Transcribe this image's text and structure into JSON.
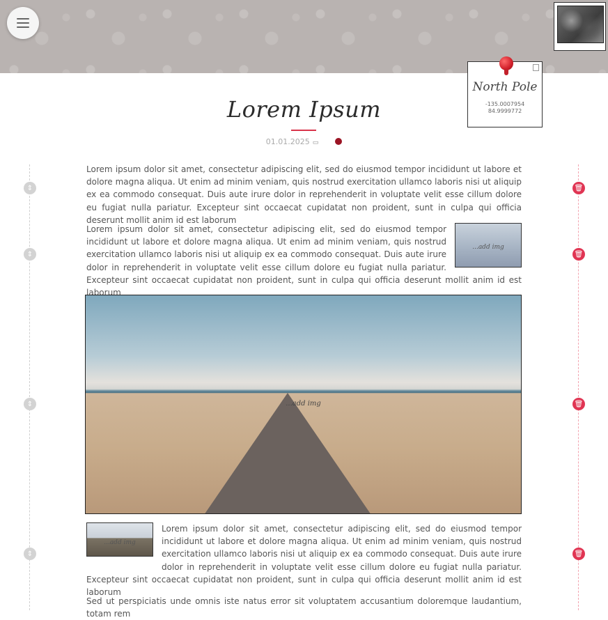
{
  "header": {
    "menu_icon": "hamburger-icon",
    "map_thumbnail": "map-thumbnail"
  },
  "location": {
    "name": "North Pole",
    "longitude": "-135.0007954",
    "latitude": "84.9999772",
    "pin_icon": "pushpin-icon",
    "corner_icon": "document-icon"
  },
  "post": {
    "title": "Lorem Ipsum",
    "date": "01.01.2025",
    "date_icon": "calendar-icon",
    "accent_color": "#9b1424",
    "rule_color": "#d9334a"
  },
  "blocks": [
    {
      "type": "text",
      "text": "Lorem ipsum dolor sit amet, consectetur adipiscing elit, sed do eiusmod tempor incididunt ut labore et dolore magna aliqua. Ut enim ad minim veniam, quis nostrud exercitation ullamco laboris nisi ut aliquip ex ea commodo consequat. Duis aute irure dolor in reprehenderit in voluptate velit esse cillum dolore eu fugiat nulla pariatur. Excepteur sint occaecat cupidatat non proident, sunt in culpa qui officia deserunt mollit anim id est laborum"
    },
    {
      "type": "text-image-right",
      "text": "Lorem ipsum dolor sit amet, consectetur adipiscing elit, sed do eiusmod tempor incididunt ut labore et dolore magna aliqua. Ut enim ad minim veniam, quis nostrud exercitation ullamco laboris nisi ut aliquip ex ea commodo consequat. Duis aute irure dolor in reprehenderit in voluptate velit esse cillum dolore eu fugiat nulla pariatur. Excepteur sint occaecat cupidatat non proident, sunt in culpa qui officia deserunt mollit anim id est laborum",
      "image_caption": "...add img"
    },
    {
      "type": "image",
      "image_caption": "...add img"
    },
    {
      "type": "text-image-left",
      "text": "Lorem ipsum dolor sit amet, consectetur adipiscing elit, sed do eiusmod tempor incididunt ut labore et dolore magna aliqua. Ut enim ad minim veniam, quis nostrud exercitation ullamco laboris nisi ut aliquip ex ea commodo consequat. Duis aute irure dolor in reprehenderit in voluptate velit esse cillum dolore eu fugiat nulla pariatur. Excepteur sint occaecat cupidatat non proident, sunt in culpa qui officia deserunt mollit anim id est laborum",
      "image_caption": "...add img"
    },
    {
      "type": "text",
      "text": "Sed ut perspiciatis unde omnis iste natus error sit voluptatem accusantium doloremque laudantium, totam rem"
    }
  ],
  "controls": {
    "move_icon": "drag-handle-icon",
    "delete_icon": "trash-icon",
    "delete_color": "#e03553"
  }
}
